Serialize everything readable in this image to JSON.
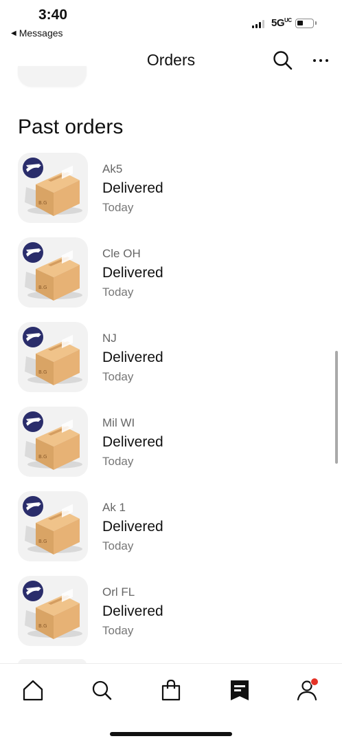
{
  "status_bar": {
    "time": "3:40",
    "back_label": "Messages",
    "back_icon": "back-triangle-icon",
    "network": "5G",
    "network_superscript": "UC"
  },
  "header": {
    "title": "Orders",
    "search_icon": "search-icon",
    "more_icon": "more-horizontal-icon"
  },
  "section": {
    "title": "Past orders"
  },
  "orders": [
    {
      "name": "Ak5",
      "status": "Delivered",
      "date": "Today",
      "thumbnail": "usps-package-image"
    },
    {
      "name": "Cle OH",
      "status": "Delivered",
      "date": "Today",
      "thumbnail": "usps-package-image"
    },
    {
      "name": "NJ",
      "status": "Delivered",
      "date": "Today",
      "thumbnail": "usps-package-image"
    },
    {
      "name": "Mil WI",
      "status": "Delivered",
      "date": "Today",
      "thumbnail": "usps-package-image"
    },
    {
      "name": "Ak 1",
      "status": "Delivered",
      "date": "Today",
      "thumbnail": "usps-package-image"
    },
    {
      "name": "Orl FL",
      "status": "Delivered",
      "date": "Today",
      "thumbnail": "usps-package-image"
    }
  ],
  "tab_bar": {
    "tabs": [
      {
        "icon": "home-icon",
        "active": false
      },
      {
        "icon": "search-icon",
        "active": false
      },
      {
        "icon": "shopping-bag-icon",
        "active": false
      },
      {
        "icon": "orders-receipt-icon",
        "active": true
      },
      {
        "icon": "profile-icon",
        "active": false,
        "badge": true
      }
    ]
  },
  "colors": {
    "badge": "#e53226",
    "usps_blue": "#2a2d6b",
    "box_tan": "#d9a465",
    "thumb_bg": "#f2f2f2"
  }
}
